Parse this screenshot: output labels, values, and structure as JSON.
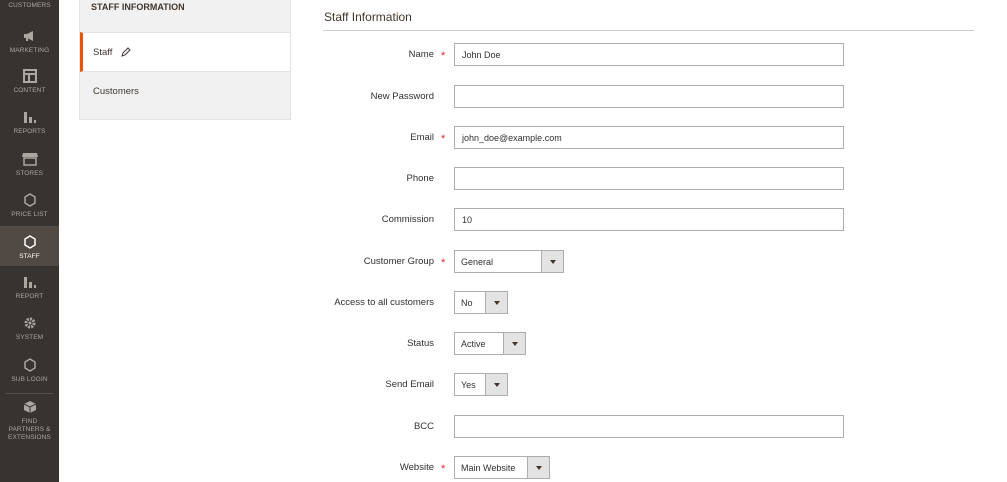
{
  "menu": {
    "items": [
      {
        "label": "CUSTOMERS",
        "icon": "customers-icon"
      },
      {
        "label": "MARKETING",
        "icon": "megaphone-icon"
      },
      {
        "label": "CONTENT",
        "icon": "content-icon"
      },
      {
        "label": "REPORTS",
        "icon": "bar-chart-icon"
      },
      {
        "label": "STORES",
        "icon": "store-icon"
      },
      {
        "label": "PRICE LIST",
        "icon": "hexagon-icon"
      },
      {
        "label": "STAFF",
        "icon": "hexagon-icon",
        "active": true
      },
      {
        "label": "REPORT",
        "icon": "bar-chart-icon"
      },
      {
        "label": "SYSTEM",
        "icon": "gear-icon"
      },
      {
        "label": "SUB LOGIN",
        "icon": "hexagon-icon"
      },
      {
        "label": "FIND PARTNERS & EXTENSIONS",
        "icon": "box-icon"
      }
    ]
  },
  "tabs": {
    "title": "STAFF INFORMATION",
    "items": [
      {
        "label": "Staff",
        "active": true
      },
      {
        "label": "Customers",
        "active": false
      }
    ]
  },
  "form": {
    "title": "Staff Information",
    "fields": {
      "name": {
        "label": "Name",
        "value": "John Doe",
        "required": true
      },
      "new_password": {
        "label": "New Password",
        "value": ""
      },
      "email": {
        "label": "Email",
        "value": "john_doe@example.com",
        "required": true
      },
      "phone": {
        "label": "Phone",
        "value": ""
      },
      "commission": {
        "label": "Commission",
        "value": "10"
      },
      "customer_group": {
        "label": "Customer Group",
        "value": "General",
        "required": true
      },
      "access_all": {
        "label": "Access to all customers",
        "value": "No"
      },
      "status": {
        "label": "Status",
        "value": "Active"
      },
      "send_email": {
        "label": "Send Email",
        "value": "Yes"
      },
      "bcc": {
        "label": "BCC",
        "value": ""
      },
      "website": {
        "label": "Website",
        "value": "Main Website",
        "required": true
      }
    },
    "required_mark": "*",
    "select_arrow": "▼"
  },
  "colors": {
    "menu_bg": "#373330",
    "menu_active_bg": "#514943",
    "accent": "#eb5202",
    "required": "#e22626"
  }
}
